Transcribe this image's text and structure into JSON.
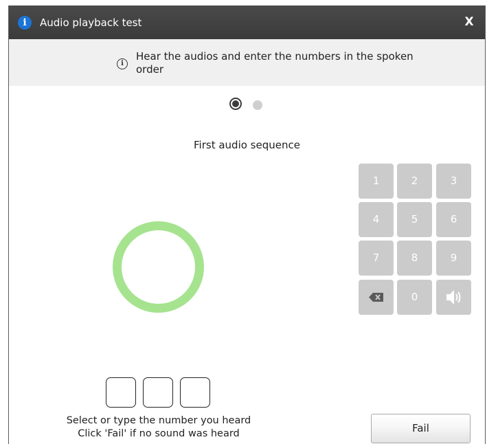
{
  "window": {
    "title": "Audio playback test",
    "title_icon": "info-icon",
    "close_label": "X"
  },
  "info": {
    "icon": "info-circle-icon",
    "text": "Hear the audios and enter the numbers in the spoken order"
  },
  "steps": {
    "total": 2,
    "current": 1
  },
  "sequence_label": "First audio sequence",
  "ring_color": "#a6e38f",
  "keypad": {
    "keys": [
      "1",
      "2",
      "3",
      "4",
      "5",
      "6",
      "7",
      "8",
      "9",
      "",
      "0",
      ""
    ],
    "backspace_icon": "backspace-icon",
    "speaker_icon": "speaker-icon",
    "key_color": "#cbcbcb"
  },
  "digits": [
    "",
    "",
    ""
  ],
  "instructions": {
    "line1": "Select or type the number you heard",
    "line2": "Click 'Fail' if no sound was heard"
  },
  "fail_label": "Fail"
}
